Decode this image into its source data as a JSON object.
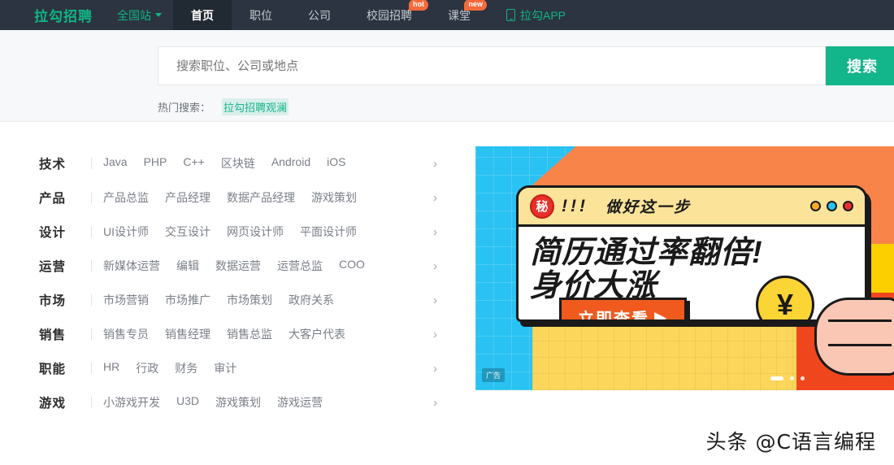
{
  "nav": {
    "logo": "拉勾招聘",
    "site_picker": "全国站",
    "items": [
      {
        "label": "首页",
        "active": true,
        "badge": ""
      },
      {
        "label": "职位",
        "active": false,
        "badge": ""
      },
      {
        "label": "公司",
        "active": false,
        "badge": ""
      },
      {
        "label": "校园招聘",
        "active": false,
        "badge": "hot"
      },
      {
        "label": "课堂",
        "active": false,
        "badge": "new"
      }
    ],
    "app_link": "拉勾APP",
    "bg_color": "#2b3440",
    "accent_color": "#11b584",
    "badge_color": "#f56a3c"
  },
  "search": {
    "placeholder": "搜索职位、公司或地点",
    "value": "",
    "button_label": "搜索",
    "hot_label": "热门搜索：",
    "hot_keyword": "拉勾招聘观澜",
    "button_color": "#13b58a"
  },
  "categories": [
    {
      "name": "技术",
      "subs": [
        "Java",
        "PHP",
        "C++",
        "区块链",
        "Android",
        "iOS"
      ]
    },
    {
      "name": "产品",
      "subs": [
        "产品总监",
        "产品经理",
        "数据产品经理",
        "游戏策划"
      ]
    },
    {
      "name": "设计",
      "subs": [
        "UI设计师",
        "交互设计",
        "网页设计师",
        "平面设计师"
      ]
    },
    {
      "name": "运营",
      "subs": [
        "新媒体运营",
        "编辑",
        "数据运营",
        "运营总监",
        "COO"
      ]
    },
    {
      "name": "市场",
      "subs": [
        "市场营销",
        "市场推广",
        "市场策划",
        "政府关系"
      ]
    },
    {
      "name": "销售",
      "subs": [
        "销售专员",
        "销售经理",
        "销售总监",
        "大客户代表"
      ]
    },
    {
      "name": "职能",
      "subs": [
        "HR",
        "行政",
        "财务",
        "审计"
      ]
    },
    {
      "name": "游戏",
      "subs": [
        "小游戏开发",
        "U3D",
        "游戏策划",
        "游戏运营"
      ]
    }
  ],
  "chevron": "›",
  "banner": {
    "seal": "秘",
    "bangs": "!!!",
    "headline_small": "做好这一步",
    "headline_line1": "简历通过率翻倍!",
    "headline_line2": "身价大涨",
    "cta_label": "立即查看",
    "cta_arrow": "▶",
    "coin_symbol": "¥",
    "ad_tag": "广告",
    "colors": {
      "cyan": "#29c2f2",
      "orange": "#f9844a",
      "yellow": "#fcd65a",
      "cta_orange": "#f05a1e",
      "seal_red": "#e8302a"
    }
  },
  "watermark": "头条 @C语言编程"
}
